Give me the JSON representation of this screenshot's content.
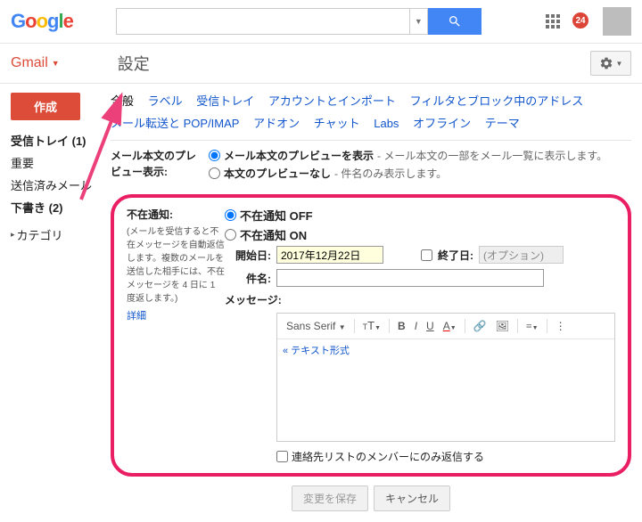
{
  "logo_text": "Google",
  "notif_count": "24",
  "gmail_label": "Gmail",
  "page_title": "設定",
  "compose": "作成",
  "sidebar": {
    "inbox": "受信トレイ (1)",
    "important": "重要",
    "sent": "送信済みメール",
    "drafts": "下書き (2)",
    "category": "カテゴリ"
  },
  "tabs": {
    "general": "全般",
    "labels": "ラベル",
    "inbox": "受信トレイ",
    "accounts": "アカウントとインポート",
    "filters": "フィルタとブロック中のアドレス",
    "forwarding": "メール転送と POP/IMAP",
    "addons": "アドオン",
    "chat": "チャット",
    "labs": "Labs",
    "offline": "オフライン",
    "themes": "テーマ"
  },
  "preview": {
    "label": "メール本文のプレビュー表示:",
    "opt1_bold": "メール本文のプレビューを表示",
    "opt1_rest": " - メール本文の一部をメール一覧に表示します。",
    "opt2_bold": "本文のプレビューなし",
    "opt2_rest": " - 件名のみ表示します。"
  },
  "vacation": {
    "header": "不在通知:",
    "desc": "(メールを受信すると不在メッセージを自動返信します。複数のメールを送信した相手には、不在メッセージを 4 日に 1 度返します。)",
    "details": "詳細",
    "off": "不在通知 OFF",
    "on": "不在通知 ON",
    "start_label": "開始日:",
    "start_value": "2017年12月22日",
    "end_label": "終了日:",
    "end_placeholder": "(オプション)",
    "subject_label": "件名:",
    "message_label": "メッセージ:",
    "font": "Sans Serif",
    "plain": "« テキスト形式",
    "contacts_only": "連絡先リストのメンバーにのみ返信する"
  },
  "buttons": {
    "save": "変更を保存",
    "cancel": "キャンセル"
  }
}
